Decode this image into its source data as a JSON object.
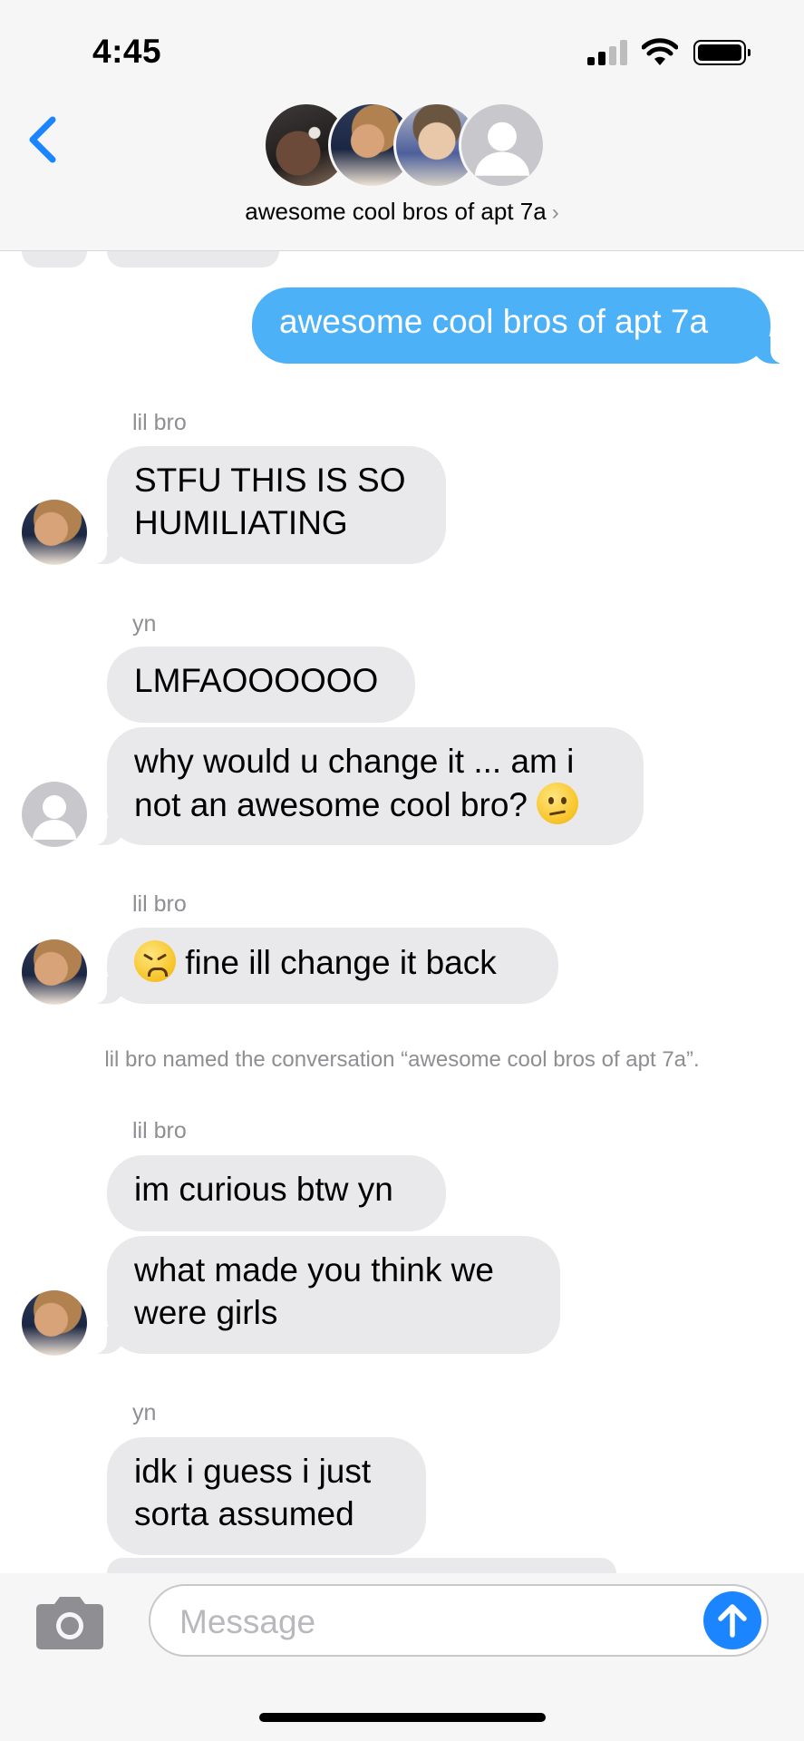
{
  "status_bar": {
    "time": "4:45"
  },
  "header": {
    "group_name": "awesome cool bros of apt 7a",
    "chevron": "›"
  },
  "messages": {
    "m1": {
      "text": "awesome cool bros of apt 7a"
    },
    "s1": {
      "sender": "lil bro"
    },
    "m2": {
      "text_line1": "STFU THIS IS SO",
      "text_line2": "HUMILIATING"
    },
    "s2": {
      "sender": "yn"
    },
    "m3": {
      "text": "LMFAOOOOOO"
    },
    "m4": {
      "text_line1": "why would u change it ... am i",
      "text_line2": "not an awesome cool bro? "
    },
    "s3": {
      "sender": "lil bro"
    },
    "m5": {
      "text": " fine ill change it back"
    },
    "system_note": "lil bro named the conversation “awesome cool bros of apt 7a”.",
    "s4": {
      "sender": "lil bro"
    },
    "m6": {
      "text": "im curious btw yn"
    },
    "m7": {
      "text_line1": "what made you think we",
      "text_line2": "were girls"
    },
    "s5": {
      "sender": "yn"
    },
    "m8": {
      "text_line1": "idk i guess i just",
      "text_line2": "sorta assumed"
    }
  },
  "input": {
    "placeholder": "Message"
  },
  "icons": {
    "back": "chevron-left-icon",
    "camera": "camera-icon",
    "send": "arrow-up-icon",
    "confused_emoji": "confused-face-emoji",
    "persevere_emoji": "persevering-face-emoji"
  },
  "colors": {
    "accent": "#1a85ff",
    "outgoing_bubble": "#4cb1f6",
    "incoming_bubble": "#e9e9eb",
    "secondary_text": "#8e8e93"
  }
}
